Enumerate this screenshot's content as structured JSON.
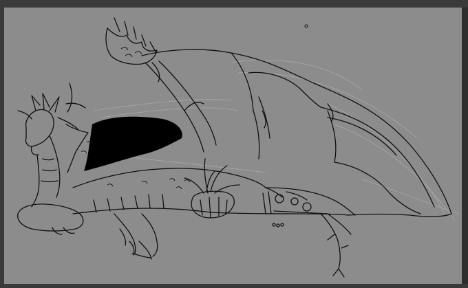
{
  "app": {
    "title": ""
  },
  "colors": {
    "workspace": "#333333",
    "canvas": "#8c8c8c",
    "lineart": "#101010",
    "sketch": "#b4b4b4",
    "fill_dark": "#000000"
  },
  "canvas": {
    "artwork": "dragon-lineart",
    "layer_hint": ""
  },
  "icons": {
    "cursor": "cursor-dot-icon"
  }
}
